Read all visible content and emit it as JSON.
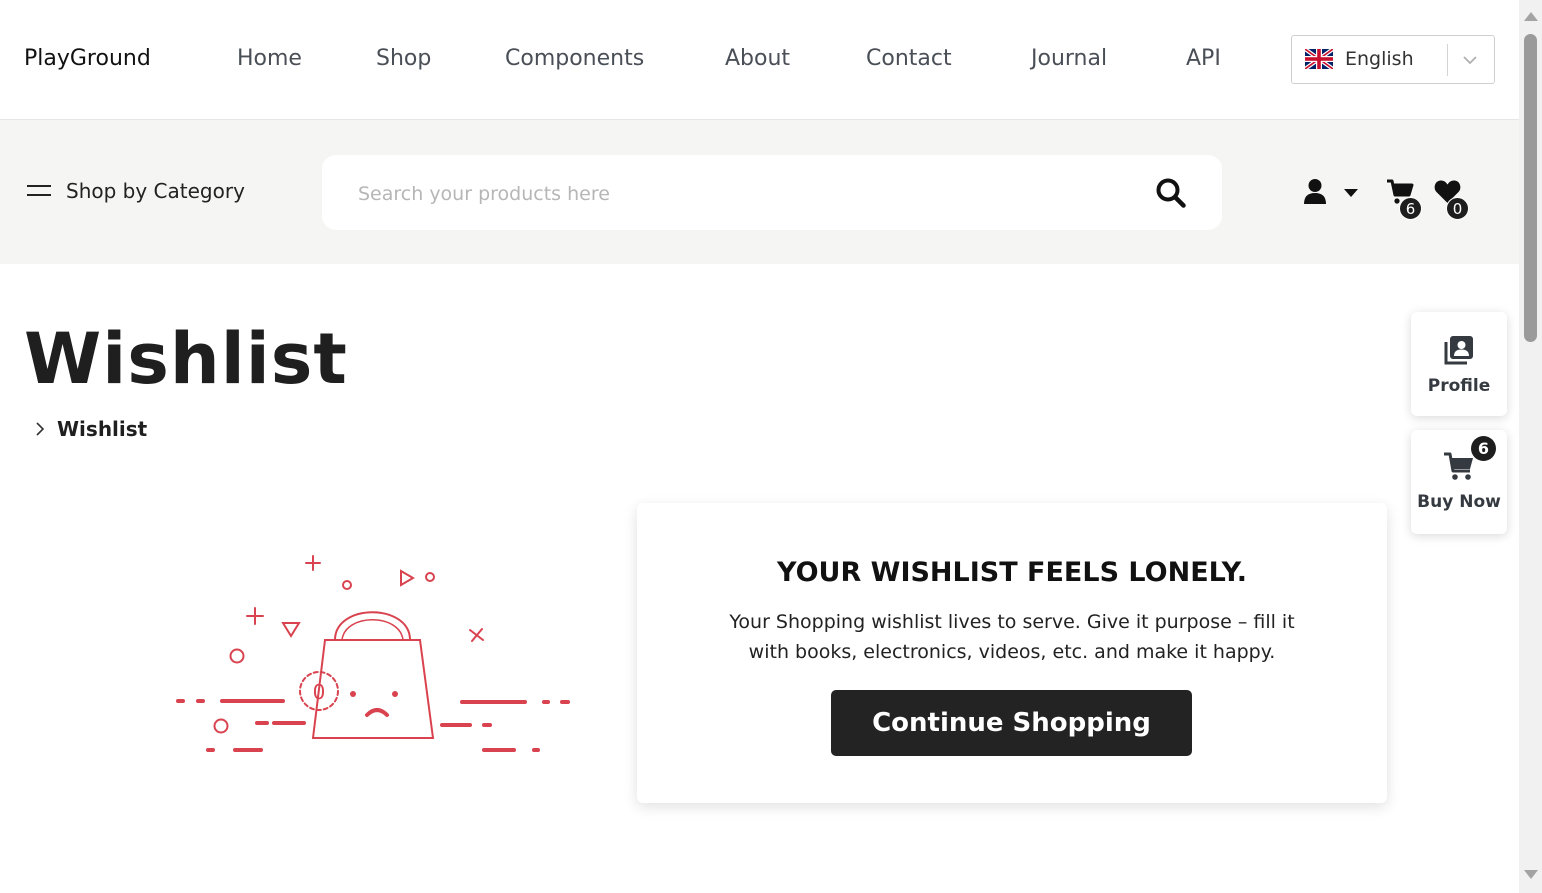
{
  "nav": {
    "brand": "PlayGround",
    "links": [
      "Home",
      "Shop",
      "Components",
      "About",
      "Contact",
      "Journal",
      "API"
    ],
    "language": {
      "label": "English",
      "flag_icon": "uk-flag-icon"
    }
  },
  "search_bar": {
    "category_label": "Shop by Category",
    "placeholder": "Search your products here",
    "value": "",
    "cart_count": "6",
    "wishlist_count": "0"
  },
  "page": {
    "title": "Wishlist",
    "breadcrumb": "Wishlist"
  },
  "empty_state": {
    "heading": "YOUR WISHLIST FEELS LONELY.",
    "message": "Your Shopping wishlist lives to serve. Give it purpose – fill it with books, electronics, videos, etc. and make it happy.",
    "button_label": "Continue Shopping",
    "illustration_text": "0"
  },
  "side_buttons": {
    "profile_label": "Profile",
    "buy_label": "Buy Now",
    "buy_count": "6"
  },
  "colors": {
    "accent_red": "#d9434f",
    "dark": "#232323",
    "band_bg": "#f5f5f3"
  }
}
